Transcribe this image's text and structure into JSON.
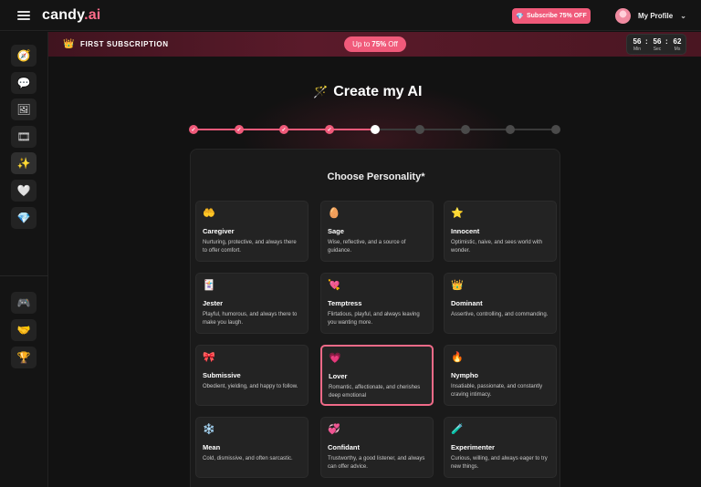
{
  "header": {
    "logo_main": "candy",
    "logo_accent": ".ai",
    "subscribe_label": "Subscribe 75% OFF",
    "profile_label": "My Profile"
  },
  "sidebar": {
    "items": [
      {
        "icon": "compass-icon",
        "glyph": "🧭"
      },
      {
        "icon": "chat-icon",
        "glyph": "💬"
      },
      {
        "icon": "gallery-icon",
        "glyph": "🖼"
      },
      {
        "icon": "collection-icon",
        "glyph": "🎞"
      },
      {
        "icon": "magic-wand-icon",
        "glyph": "✨",
        "active": true
      },
      {
        "icon": "heart-pair-icon",
        "glyph": "🤍"
      },
      {
        "icon": "diamond-icon",
        "glyph": "💎"
      }
    ],
    "bottom_items": [
      {
        "icon": "discord-icon",
        "glyph": "🎮"
      },
      {
        "icon": "affiliate-icon",
        "glyph": "🤝"
      },
      {
        "icon": "trophy-icon",
        "glyph": "🏆"
      }
    ]
  },
  "banner": {
    "title": "FIRST SUBSCRIPTION",
    "pill_prefix": "Up to",
    "pill_bold": "75%",
    "pill_suffix": "Off",
    "timer": {
      "min": "56",
      "sec": "56",
      "ms": "62",
      "min_label": "Min",
      "sec_label": "Sec",
      "ms_label": "Ms"
    }
  },
  "page": {
    "title": "Create my AI",
    "steps_total": 9,
    "steps_completed": 4,
    "current_step": 5,
    "section_title": "Choose Personality*"
  },
  "personalities": [
    {
      "icon": "caregiver-icon",
      "glyph": "🤲",
      "title": "Caregiver",
      "desc": "Nurturing, protective, and always there to offer comfort."
    },
    {
      "icon": "sage-icon",
      "glyph": "🥚",
      "title": "Sage",
      "desc": "Wise, reflective, and a source of guidance."
    },
    {
      "icon": "innocent-icon",
      "glyph": "⭐",
      "title": "Innocent",
      "desc": "Optimistic, naive, and sees world with wonder."
    },
    {
      "icon": "jester-icon",
      "glyph": "🃏",
      "title": "Jester",
      "desc": "Playful, humorous, and always there to make you laugh."
    },
    {
      "icon": "temptress-icon",
      "glyph": "💘",
      "title": "Temptress",
      "desc": "Flirtatious, playful, and always leaving you wanting more."
    },
    {
      "icon": "dominant-icon",
      "glyph": "👑",
      "title": "Dominant",
      "desc": "Assertive, controlling, and commanding."
    },
    {
      "icon": "submissive-icon",
      "glyph": "🎀",
      "title": "Submissive",
      "desc": "Obedient, yielding, and happy to follow."
    },
    {
      "icon": "lover-icon",
      "glyph": "💗",
      "title": "Lover",
      "desc": "Romantic, affectionate, and cherishes deep emotional",
      "selected": true
    },
    {
      "icon": "nympho-icon",
      "glyph": "🔥",
      "title": "Nympho",
      "desc": "Insatiable, passionate, and constantly craving intimacy."
    },
    {
      "icon": "mean-icon",
      "glyph": "❄️",
      "title": "Mean",
      "desc": "Cold, dismissive, and often sarcastic."
    },
    {
      "icon": "confidant-icon",
      "glyph": "💞",
      "title": "Confidant",
      "desc": "Trustworthy, a good listener, and always can offer advice."
    },
    {
      "icon": "experimenter-icon",
      "glyph": "🧪",
      "title": "Experimenter",
      "desc": "Curious, willing, and always eager to try new things."
    }
  ],
  "colors": {
    "accent": "#f05a7a",
    "background": "#121212",
    "card": "#232323"
  }
}
